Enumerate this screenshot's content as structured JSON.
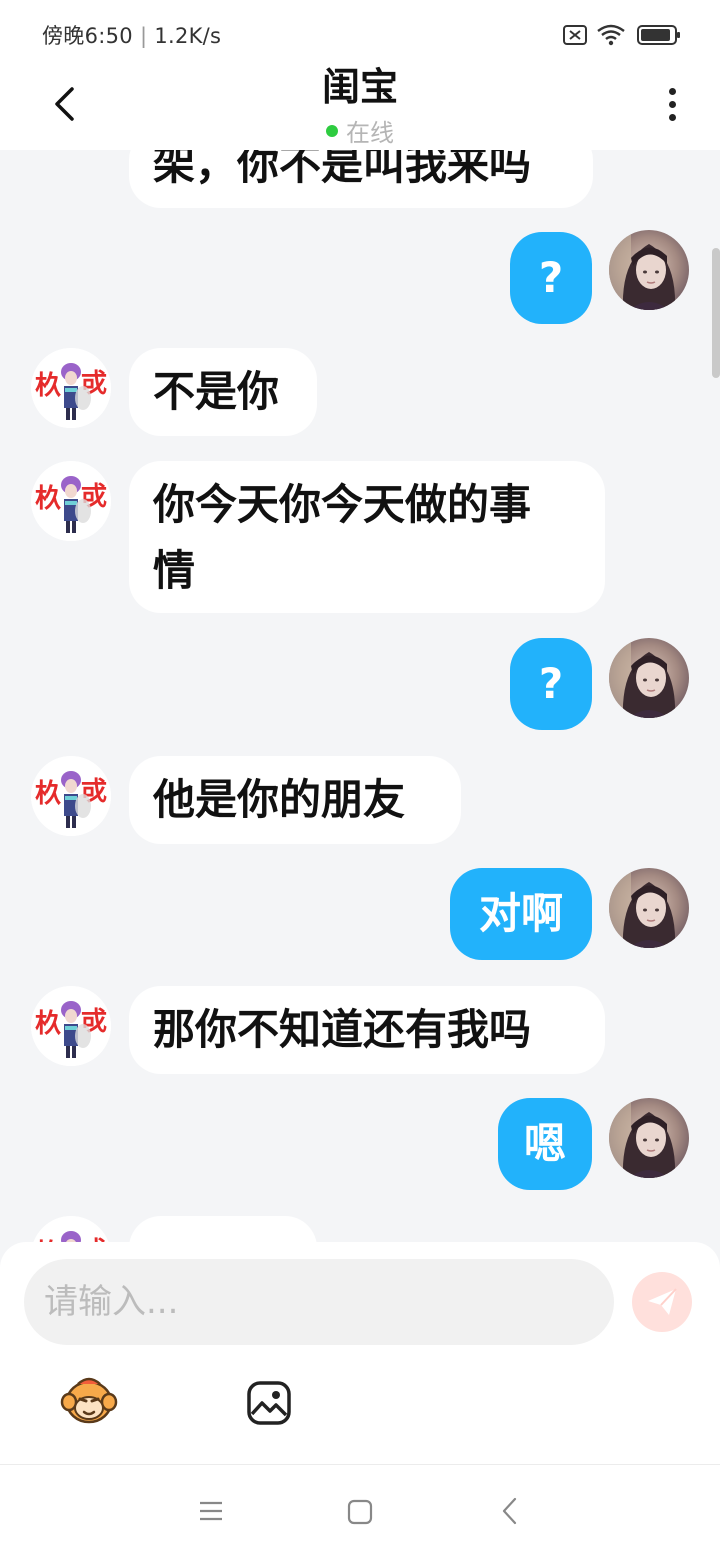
{
  "status_bar": {
    "time": "傍晚6:50",
    "net_speed": "1.2K/s",
    "icons": [
      "sim-off-icon",
      "wifi-icon",
      "battery-icon"
    ]
  },
  "header": {
    "title": "闺宝",
    "status": "在线",
    "icons": [
      "back-icon",
      "more-icon"
    ]
  },
  "colors": {
    "accent": "#22b2fb",
    "online": "#2ecc40",
    "send": "#ffe0dc"
  },
  "messages": [
    {
      "side": "left",
      "text": "架，你不是叫我来吗"
    },
    {
      "side": "right",
      "text": "?"
    },
    {
      "side": "left",
      "text": "不是你"
    },
    {
      "side": "left",
      "text": "你今天你今天做的事",
      "text2": "情"
    },
    {
      "side": "right",
      "text": "?"
    },
    {
      "side": "left",
      "text": "他是你的朋友"
    },
    {
      "side": "right",
      "text": "对啊"
    },
    {
      "side": "left",
      "text": "那你不知道还有我吗"
    },
    {
      "side": "right",
      "text": "嗯"
    }
  ],
  "input": {
    "placeholder": "请输入..."
  },
  "toolbar": {
    "icons": [
      "emoji-icon",
      "image-icon",
      "send-icon"
    ]
  },
  "nav": {
    "icons": [
      "menu-icon",
      "home-icon",
      "back-nav-icon"
    ]
  }
}
